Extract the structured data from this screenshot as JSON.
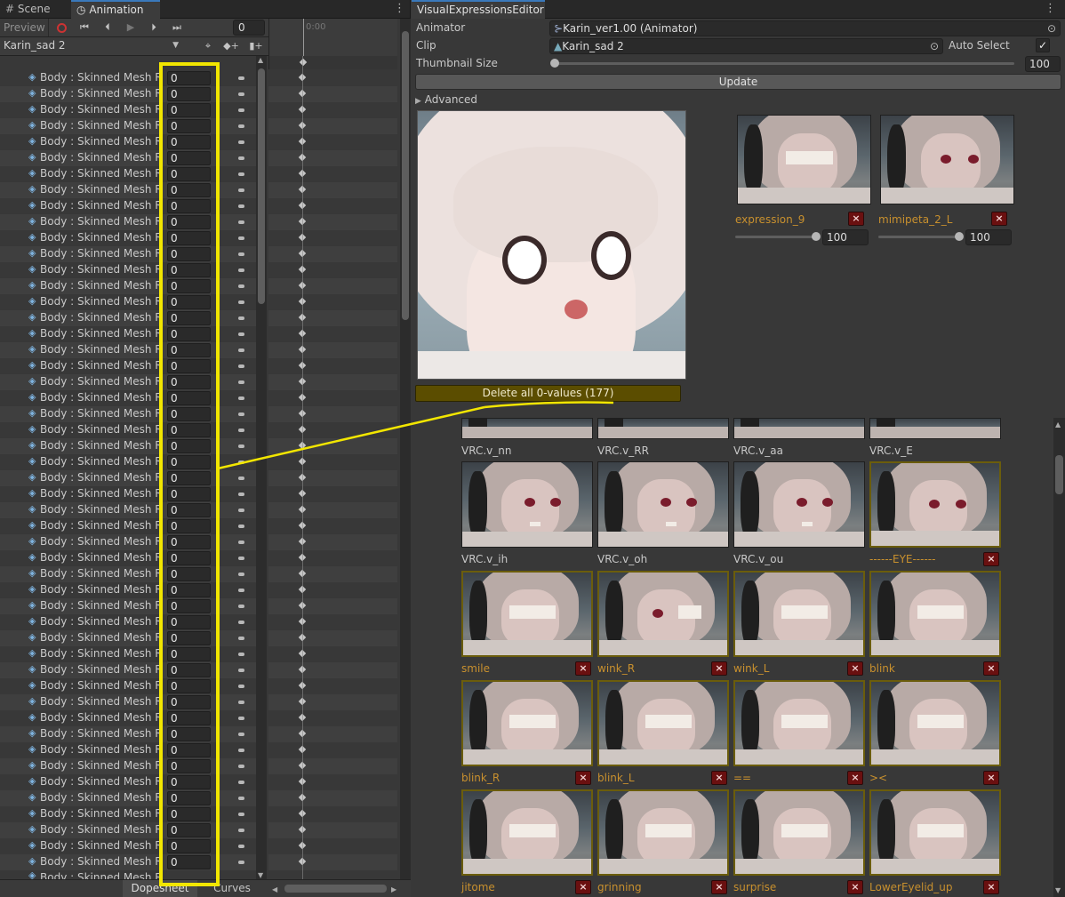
{
  "left_tabs": {
    "scene": "Scene",
    "animation": "Animation"
  },
  "anim_toolbar": {
    "preview": "Preview",
    "frame": "0",
    "time_label": "0:00"
  },
  "clip_select": {
    "value": "Karin_sad 2"
  },
  "property_rows": {
    "label": "Body : Skinned Mesh Re",
    "values": [
      "0",
      "0",
      "0",
      "0",
      "0",
      "0",
      "0",
      "0",
      "0",
      "0",
      "0",
      "0",
      "0",
      "0",
      "0",
      "0",
      "0",
      "0",
      "0",
      "0",
      "0",
      "0",
      "0",
      "0",
      "0",
      "0",
      "0",
      "0",
      "0",
      "0",
      "0",
      "0",
      "0",
      "0",
      "0",
      "0",
      "0",
      "0",
      "0",
      "0",
      "0",
      "0",
      "0",
      "0",
      "0",
      "0",
      "0",
      "0",
      "0",
      "0",
      "0",
      "0"
    ],
    "partial": "Body : Skinned Mesh Re"
  },
  "bottom_tabs": {
    "dopesheet": "Dopesheet",
    "curves": "Curves"
  },
  "editor": {
    "tab": "VisualExpressionsEditor",
    "animator_label": "Animator",
    "animator_value": "Karin_ver1.00 (Animator)",
    "clip_label": "Clip",
    "clip_value": "Karin_sad 2",
    "auto_select": "Auto Select",
    "auto_select_checked": "✓",
    "thumb_size_label": "Thumbnail Size",
    "thumb_size_value": "100",
    "update_button": "Update",
    "advanced": "Advanced",
    "delete_button": "Delete all 0-values (177)"
  },
  "active_expressions": [
    {
      "name": "expression_9",
      "value": "100"
    },
    {
      "name": "mimipeta_2_L",
      "value": "100"
    }
  ],
  "grid": {
    "row0": [
      "VRC.v_nn",
      "VRC.v_RR",
      "VRC.v_aa",
      "VRC.v_E"
    ],
    "row1": [
      "VRC.v_ih",
      "VRC.v_oh",
      "VRC.v_ou",
      "------EYE------"
    ],
    "row2": [
      "smile",
      "wink_R",
      "wink_L",
      "blink"
    ],
    "row3": [
      "blink_R",
      "blink_L",
      "==",
      "><"
    ],
    "row4": [
      "jitome",
      "grinning",
      "surprise",
      "LowerEyelid_up"
    ]
  },
  "colors": {
    "highlight": "#f2e600",
    "accent_text": "#c8902e",
    "delete_bg": "#5b4d00",
    "thumb_border": "#6b5d0c",
    "x_button": "#6a1010"
  }
}
